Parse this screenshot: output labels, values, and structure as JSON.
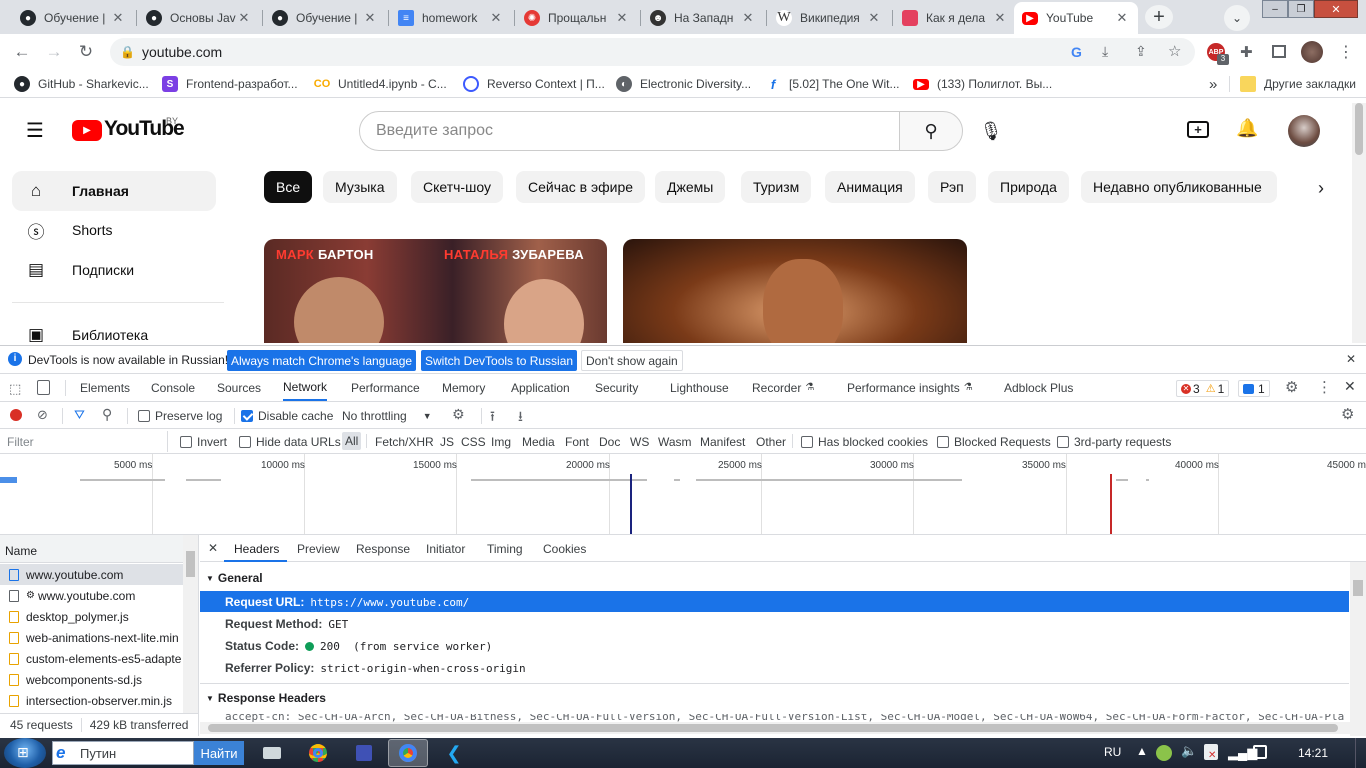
{
  "browser": {
    "tabs": [
      {
        "title": "Обучение |",
        "icon": "github-icon",
        "color": "#24292e"
      },
      {
        "title": "Основы Jav",
        "icon": "github-icon",
        "color": "#24292e"
      },
      {
        "title": "Обучение |",
        "icon": "github-icon",
        "color": "#24292e"
      },
      {
        "title": "homework",
        "icon": "document-icon",
        "color": "#4285f4"
      },
      {
        "title": "Прощальн",
        "icon": "burst-icon",
        "color": "#e53935"
      },
      {
        "title": "На Западн",
        "icon": "avatar-icon",
        "color": "#333333"
      },
      {
        "title": "Википедия",
        "icon": "wikipedia-icon",
        "color": "#444444"
      },
      {
        "title": "Как я дела",
        "icon": "red-square-icon",
        "color": "#e4405f"
      },
      {
        "title": "YouTube",
        "icon": "youtube-icon",
        "color": "#ff0000"
      }
    ],
    "url": "youtube.com",
    "extension_badge": "3",
    "bookmarks": [
      {
        "label": "GitHub - Sharkevic...",
        "icon": "github-icon",
        "color": "#24292e"
      },
      {
        "label": "Frontend-разработ...",
        "icon": "s-icon",
        "color": "#7b3fe4"
      },
      {
        "label": "Untitled4.ipynb - C...",
        "icon": "colab-icon",
        "color": "#f9ab00"
      },
      {
        "label": "Reverso Context | П...",
        "icon": "reverso-icon",
        "color": "#3d5afe"
      },
      {
        "label": "Electronic Diversity...",
        "icon": "globe-icon",
        "color": "#5f6368"
      },
      {
        "label": "[5.02] The One Wit...",
        "icon": "f-icon",
        "color": "#1a73e8"
      },
      {
        "label": "(133) Полиглот. Вы...",
        "icon": "youtube-icon",
        "color": "#ff0000"
      }
    ],
    "bookmarks_more": "»",
    "other_bookmarks": "Другие закладки"
  },
  "youtube": {
    "logo_text": "YouTube",
    "region": "BY",
    "search_placeholder": "Введите запрос",
    "sidebar": [
      {
        "label": "Главная",
        "icon": "home-icon"
      },
      {
        "label": "Shorts",
        "icon": "shorts-icon"
      },
      {
        "label": "Подписки",
        "icon": "subscriptions-icon"
      },
      {
        "label": "Библиотека",
        "icon": "library-icon"
      }
    ],
    "chips": [
      "Все",
      "Музыка",
      "Скетч-шоу",
      "Сейчас в эфире",
      "Джемы",
      "Туризм",
      "Анимация",
      "Рэп",
      "Природа",
      "Недавно опубликованные"
    ],
    "thumb1_left": "МАРК БАРТОН",
    "thumb1_right": "НАТАЛЬЯ ЗУБАРЕВА",
    "thumb1_left_a": "МАРК",
    "thumb1_left_b": "БАРТОН",
    "thumb1_right_a": "НАТАЛЬЯ",
    "thumb1_right_b": "ЗУБАРЕВА"
  },
  "devtools": {
    "infobar_text": "DevTools is now available in Russian!",
    "infobar_btn1": "Always match Chrome's language",
    "infobar_btn2": "Switch DevTools to Russian",
    "infobar_btn3": "Don't show again",
    "tabs": [
      "Elements",
      "Console",
      "Sources",
      "Network",
      "Performance",
      "Memory",
      "Application",
      "Security",
      "Lighthouse",
      "Recorder",
      "Performance insights",
      "Adblock Plus"
    ],
    "errors": "3",
    "warnings": "1",
    "messages": "1",
    "preserve_log": "Preserve log",
    "disable_cache": "Disable cache",
    "throttling": "No throttling",
    "filter_placeholder": "Filter",
    "invert": "Invert",
    "hide_data_urls": "Hide data URLs",
    "types": [
      "All",
      "Fetch/XHR",
      "JS",
      "CSS",
      "Img",
      "Media",
      "Font",
      "Doc",
      "WS",
      "Wasm",
      "Manifest",
      "Other"
    ],
    "blocked_cookies": "Has blocked cookies",
    "blocked_requests": "Blocked Requests",
    "third_party": "3rd-party requests",
    "timeline_ticks": [
      "5000 ms",
      "10000 ms",
      "15000 ms",
      "20000 ms",
      "25000 ms",
      "30000 ms",
      "35000 ms",
      "40000 ms",
      "45000 m"
    ],
    "name_header": "Name",
    "requests": [
      "www.youtube.com",
      "www.youtube.com",
      "desktop_polymer.js",
      "web-animations-next-lite.min",
      "custom-elements-es5-adapte",
      "webcomponents-sd.js",
      "intersection-observer.min.js"
    ],
    "summary_requests": "45 requests",
    "summary_transferred": "429 kB transferred",
    "detail_tabs": [
      "Headers",
      "Preview",
      "Response",
      "Initiator",
      "Timing",
      "Cookies"
    ],
    "general_title": "General",
    "request_url_k": "Request URL:",
    "request_url_v": "https://www.youtube.com/",
    "method_k": "Request Method:",
    "method_v": "GET",
    "status_k": "Status Code:",
    "status_v": "200  (from service worker)",
    "referrer_k": "Referrer Policy:",
    "referrer_v": "strict-origin-when-cross-origin",
    "response_headers_title": "Response Headers",
    "accept_ch": "accept-ch: Sec-CH-UA-Arch, Sec-CH-UA-Bitness, Sec-CH-UA-Full-Version, Sec-CH-UA-Full-Version-List, Sec-CH-UA-Model, Sec-CH-UA-WoW64, Sec-CH-UA-Form-Factor, Sec-CH-UA-Platf"
  },
  "taskbar": {
    "search_value": "Путин",
    "search_button": "Найти",
    "lang": "RU",
    "time": "14:21"
  }
}
